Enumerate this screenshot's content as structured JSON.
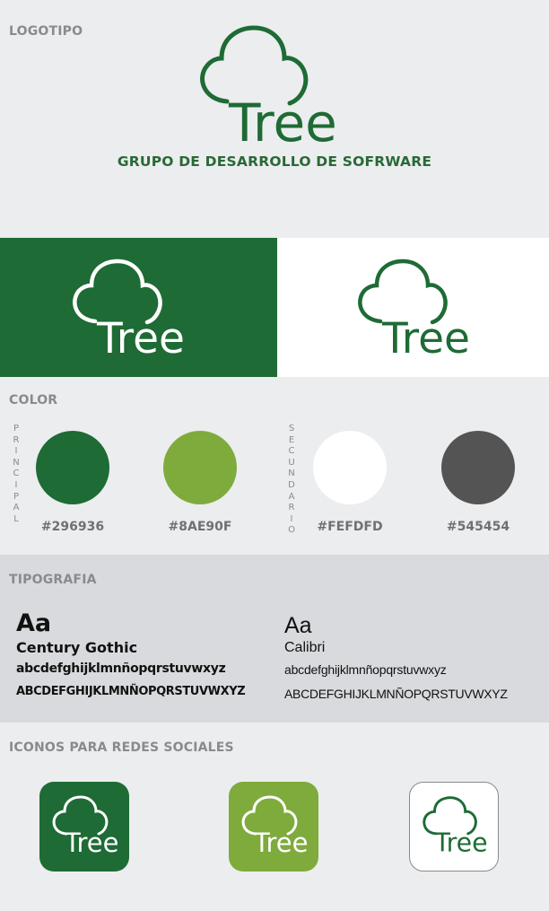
{
  "sections": {
    "logo_title": "LOGOTIPO",
    "color_title": "COLOR",
    "typography_title": "TIPOGRAFIA",
    "social_title": "ICONOS PARA REDES SOCIALES"
  },
  "logo": {
    "wordmark": "Tree",
    "tagline": "GRUPO DE DESARROLLO DE SOFRWARE"
  },
  "colors": {
    "primary_label": "PRINCIPAL",
    "secondary_label": "SECUNDARIO",
    "swatches": [
      {
        "hex": "#296936",
        "label": "#296936"
      },
      {
        "hex": "#8AE90F",
        "label": "#8AE90F",
        "rendered": "#7eab3b"
      },
      {
        "hex": "#FEFDFD",
        "label": "#FEFDFD"
      },
      {
        "hex": "#545454",
        "label": "#545454"
      }
    ]
  },
  "typography": {
    "fonts": [
      {
        "sample": "Aa",
        "name": "Century Gothic",
        "lowercase": "abcdefghijklmnñopqrstuvwxyz",
        "uppercase": "ABCDEFGHIJKLMNÑOPQRSTUVWXYZ"
      },
      {
        "sample": "Aa",
        "name": "Calibri",
        "lowercase": "abcdefghijklmnñopqrstuvwxyz",
        "uppercase": "ABCDEFGHIJKLMNÑOPQRSTUVWXYZ"
      }
    ]
  },
  "brand_colors": {
    "green_dark": "#1e6b35",
    "green_light": "#7eab3b",
    "white": "#ffffff",
    "grey_bg": "#ecedef",
    "grey_band": "#d9dadd"
  }
}
